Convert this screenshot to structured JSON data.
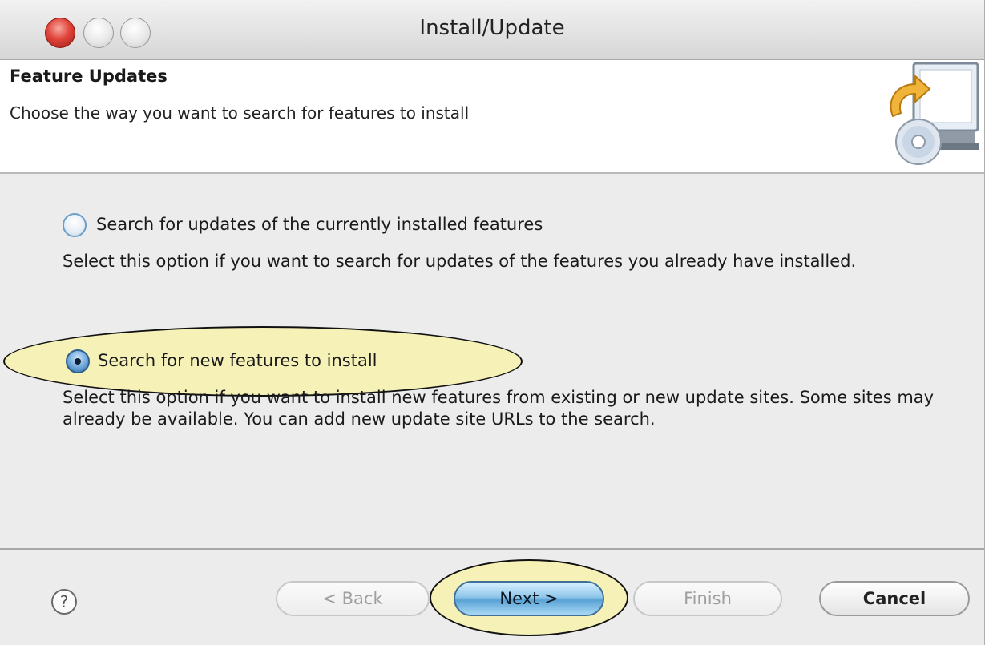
{
  "window": {
    "title": "Install/Update"
  },
  "header": {
    "title": "Feature Updates",
    "description": "Choose the way you want to search for features to install",
    "icon": "install-update-computer-cd-icon"
  },
  "options": [
    {
      "label": "Search for updates of the currently installed features",
      "description": "Select this option if you want to search for updates of the features you already have installed.",
      "selected": false
    },
    {
      "label": "Search for new features to install",
      "description": "Select this option if you want to install new features from existing or new update sites. Some sites may already be available. You can add new update site URLs to the search.",
      "selected": true
    }
  ],
  "buttons": {
    "help": "?",
    "back": "< Back",
    "next": "Next >",
    "finish": "Finish",
    "cancel": "Cancel"
  },
  "colors": {
    "highlight": "#f6f1b7",
    "accent": "#5aa3d6"
  }
}
